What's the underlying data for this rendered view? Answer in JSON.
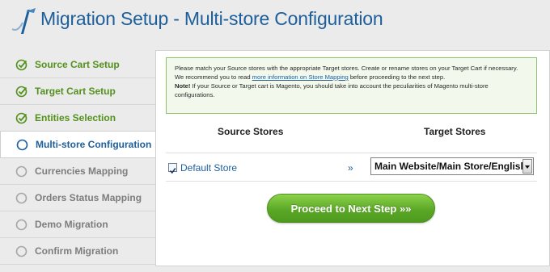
{
  "header": {
    "title": "Migration Setup - Multi-store Configuration"
  },
  "sidebar": {
    "steps": [
      {
        "label": "Source Cart Setup",
        "state": "done",
        "icon": "check-circle-icon"
      },
      {
        "label": "Target Cart Setup",
        "state": "done",
        "icon": "check-circle-icon"
      },
      {
        "label": "Entities Selection",
        "state": "done",
        "icon": "check-circle-icon"
      },
      {
        "label": "Multi-store Configuration",
        "state": "active",
        "icon": "circle-icon"
      },
      {
        "label": "Currencies Mapping",
        "state": "pending",
        "icon": "circle-icon"
      },
      {
        "label": "Orders Status Mapping",
        "state": "pending",
        "icon": "circle-icon"
      },
      {
        "label": "Demo Migration",
        "state": "pending",
        "icon": "circle-icon"
      },
      {
        "label": "Confirm Migration",
        "state": "pending",
        "icon": "circle-icon"
      }
    ]
  },
  "notice": {
    "line1_pre": "Please match your Source stores with the appropriate Target stores. Create or rename stores on your Target Cart if necessary. We recommend you to read ",
    "link": "more information on Store Mapping",
    "line1_post": " before proceeding to the next step.",
    "note_label": "Note!",
    "note_text": " If your Source or Target cart is Magento, you should take into account the peculiarities of Magento multi-store configurations."
  },
  "mapping": {
    "source_header": "Source Stores",
    "target_header": "Target Stores",
    "rows": [
      {
        "source": "Default Store",
        "checked": true,
        "arrow": "»",
        "target": "Main Website/Main Store/English"
      }
    ]
  },
  "actions": {
    "proceed_label": "Proceed to Next Step »»"
  },
  "colors": {
    "accent_blue": "#1d5f9b",
    "done_green": "#53911c",
    "button_green": "#5ba827"
  }
}
